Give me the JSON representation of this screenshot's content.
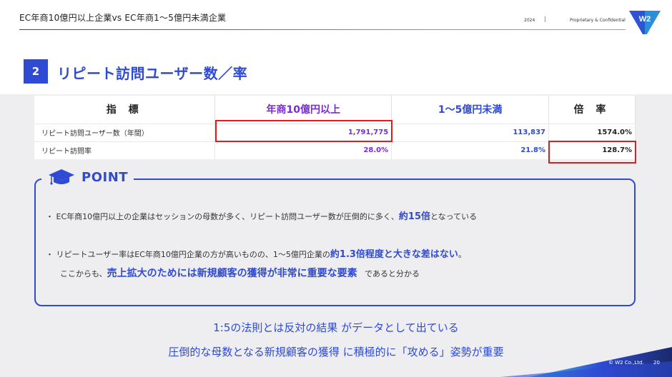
{
  "header": {
    "title": "EC年商10億円以上企業vs EC年商1〜5億円未満企業",
    "year": "2024",
    "separator": "|",
    "confidential": "Proprietary & Confidential",
    "logo_text": "W2"
  },
  "section": {
    "number": "2",
    "title": "リピート訪問ユーザー数／率"
  },
  "table": {
    "headers": [
      "指 標",
      "年商10億円以上",
      "1〜5億円未満",
      "倍 率"
    ],
    "rows": [
      {
        "label": "リピート訪問ユーザー数（年間）",
        "big": "1,791,775",
        "mid": "113,837",
        "rate": "1574.0%"
      },
      {
        "label": "リピート訪問率",
        "big": "28.0%",
        "mid": "21.8%",
        "rate": "128.7%"
      }
    ]
  },
  "point": {
    "title": "POINT",
    "bullet1_pre": "・ EC年商10億円以上の企業はセッションの母数が多く、リピート訪問ユーザー数が圧倒的に多く、",
    "bullet1_hl": "約15倍",
    "bullet1_post": "となっている",
    "bullet2_pre": "・ リピートユーザー率はEC年商10億円企業の方が高いものの、1〜5億円企業の",
    "bullet2_hl": "約1.3倍程度と大きな差はない",
    "bullet2_post": "。",
    "bullet3_pre": "ここからも、",
    "bullet3_hl": "売上拡大のためには新規顧客の獲得が非常に重要な要素",
    "bullet3_post": "であると分かる"
  },
  "conclusion": {
    "line1": "1:5の法則とは反対の結果 がデータとして出ている",
    "line2": "圧倒的な母数となる新規顧客の獲得 に積極的に「攻める」姿勢が重要"
  },
  "footer": {
    "copyright": "© W2 Co.,Ltd.",
    "page": "20"
  },
  "colors": {
    "accent_blue": "#2f4ad3",
    "purple": "#7b2bd4",
    "highlight_red": "#e01d1d",
    "background_gray": "#eeeef0"
  }
}
